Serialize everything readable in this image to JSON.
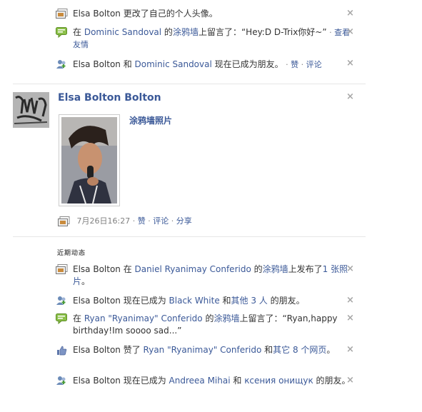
{
  "activity_top": [
    {
      "id": "a1",
      "icon": "photo-icon",
      "parts": [
        {
          "t": "Elsa Bolton 更改了自己的个人头像。",
          "l": false
        }
      ]
    },
    {
      "id": "a2",
      "icon": "wall-post-icon",
      "parts": [
        {
          "t": "在 ",
          "l": false
        },
        {
          "t": "Dominic Sandoval",
          "l": true
        },
        {
          "t": " 的",
          "l": false
        },
        {
          "t": "涂鸦墙",
          "l": true
        },
        {
          "t": "上留言了：“Hey:D D-Trix你好~”",
          "l": false
        }
      ],
      "tail": "查看友情"
    },
    {
      "id": "a3",
      "icon": "friends-icon",
      "parts": [
        {
          "t": "Elsa Bolton 和 ",
          "l": false
        },
        {
          "t": "Dominic Sandoval",
          "l": true
        },
        {
          "t": " 现在已成为朋友。",
          "l": false
        }
      ],
      "tail_links": [
        "赞",
        "评论"
      ]
    }
  ],
  "story": {
    "name": "Elsa Bolton Bolton",
    "album_title": "涂鸦墙照片",
    "timestamp": "7月26日16:27",
    "actions": [
      "赞",
      "评论",
      "分享"
    ]
  },
  "recent": {
    "heading": "近期动态",
    "items": [
      {
        "id": "r1",
        "icon": "photo-icon",
        "parts": [
          {
            "t": "Elsa Bolton 在 ",
            "l": false
          },
          {
            "t": "Daniel Ryanimay Conferido",
            "l": true
          },
          {
            "t": " 的",
            "l": false
          },
          {
            "t": "涂鸦墙",
            "l": true
          },
          {
            "t": "上发布了",
            "l": false
          },
          {
            "t": "1 张照片",
            "l": true
          },
          {
            "t": "。",
            "l": false
          }
        ]
      },
      {
        "id": "r2",
        "icon": "friends-icon",
        "parts": [
          {
            "t": "Elsa Bolton 现在已成为 ",
            "l": false
          },
          {
            "t": "Black White",
            "l": true
          },
          {
            "t": " 和",
            "l": false
          },
          {
            "t": "其他 3 人",
            "l": true
          },
          {
            "t": " 的朋友。",
            "l": false
          }
        ]
      },
      {
        "id": "r3",
        "icon": "wall-post-icon",
        "parts": [
          {
            "t": "在 ",
            "l": false
          },
          {
            "t": "Ryan \"Ryanimay\" Conferido",
            "l": true
          },
          {
            "t": " 的",
            "l": false
          },
          {
            "t": "涂鸦墙",
            "l": true
          },
          {
            "t": "上留言了：“Ryan,happy birthday!Im soooo sad...”",
            "l": false
          }
        ]
      },
      {
        "id": "r4",
        "icon": "like-icon",
        "parts": [
          {
            "t": "Elsa Bolton 赞了 ",
            "l": false
          },
          {
            "t": "Ryan \"Ryanimay\" Conferido",
            "l": true
          },
          {
            "t": " 和",
            "l": false
          },
          {
            "t": "其它 8 个网页",
            "l": true
          },
          {
            "t": "。",
            "l": false
          }
        ]
      },
      {
        "id": "r5",
        "icon": "friends-icon",
        "parts": [
          {
            "t": "Elsa Bolton 现在已成为 ",
            "l": false
          },
          {
            "t": "Andreea Mihai",
            "l": true
          },
          {
            "t": " 和 ",
            "l": false
          },
          {
            "t": "ксения онищук",
            "l": true
          },
          {
            "t": " 的朋友。",
            "l": false
          }
        ]
      }
    ]
  },
  "close_glyph": "×",
  "sep_glyph": "·"
}
